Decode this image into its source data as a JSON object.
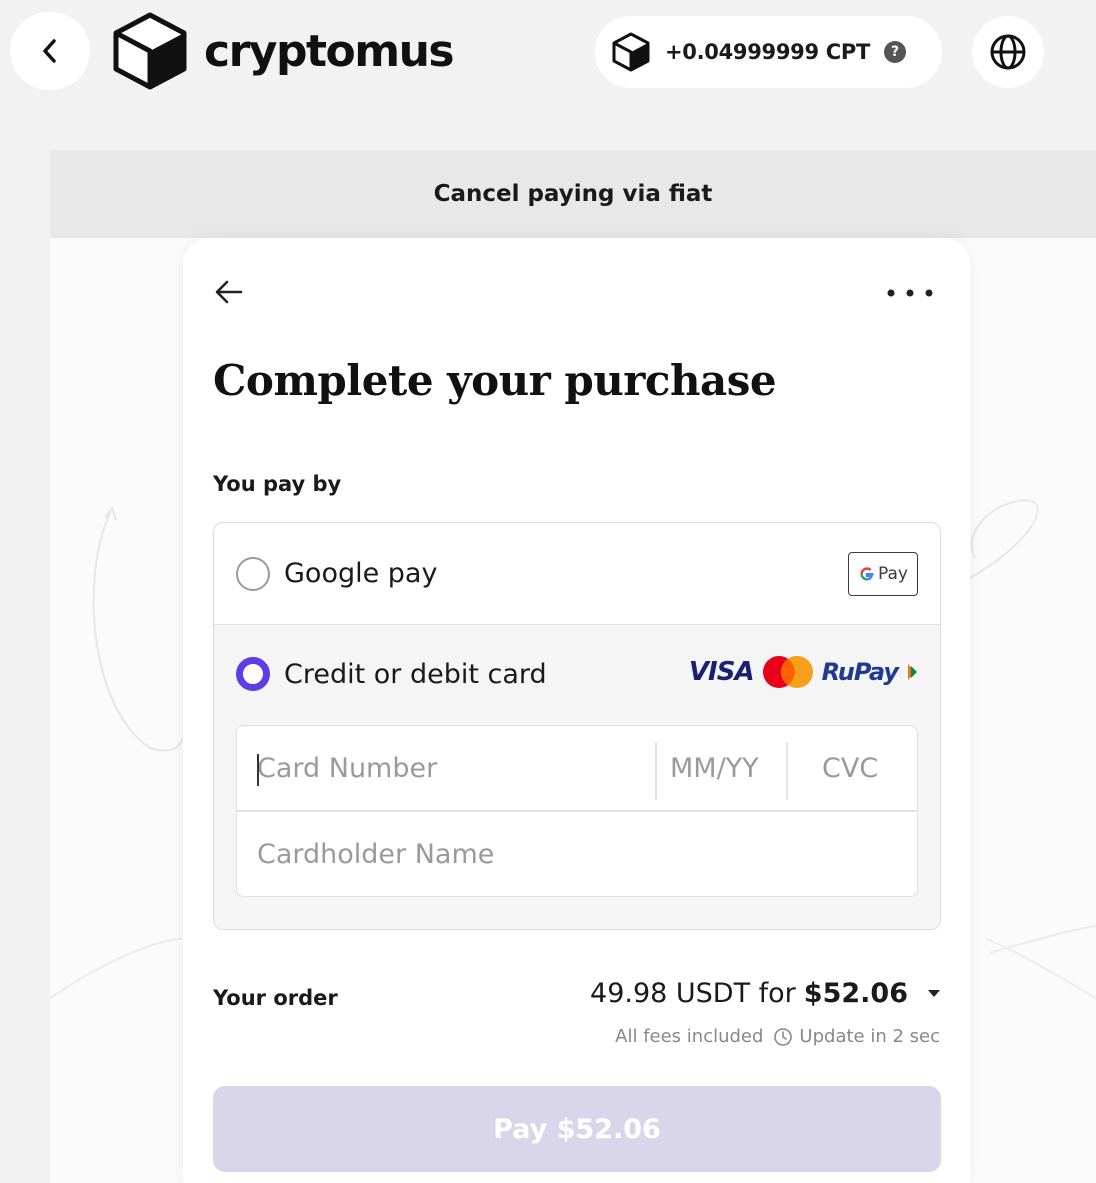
{
  "header": {
    "brand": "cryptomus",
    "balance": "+0.04999999 CPT",
    "help_glyph": "?"
  },
  "banner": {
    "text": "Cancel paying via fiat"
  },
  "card": {
    "title": "Complete your purchase",
    "pay_by_label": "You pay by",
    "methods": [
      {
        "label": "Google pay",
        "selected": false,
        "badge": "Pay"
      },
      {
        "label": "Credit or debit card",
        "selected": true
      }
    ],
    "brands": {
      "visa": "VISA",
      "rupay": "RuPay"
    },
    "fields": {
      "card_number_placeholder": "Card Number",
      "expiry_placeholder": "MM/YY",
      "cvc_placeholder": "CVC",
      "name_placeholder": "Cardholder Name"
    },
    "order": {
      "label": "Your order",
      "amount": "49.98 USDT for",
      "price": "$52.06",
      "fees": "All fees included",
      "update": "Update in 2 sec"
    },
    "pay_button": "Pay $52.06"
  },
  "colors": {
    "accent": "#5b3ee6",
    "pay_button_disabled": "#dad6ea",
    "visa_blue": "#1a1f71",
    "mastercard_red": "#eb001b",
    "mastercard_orange": "#f79e1b"
  }
}
